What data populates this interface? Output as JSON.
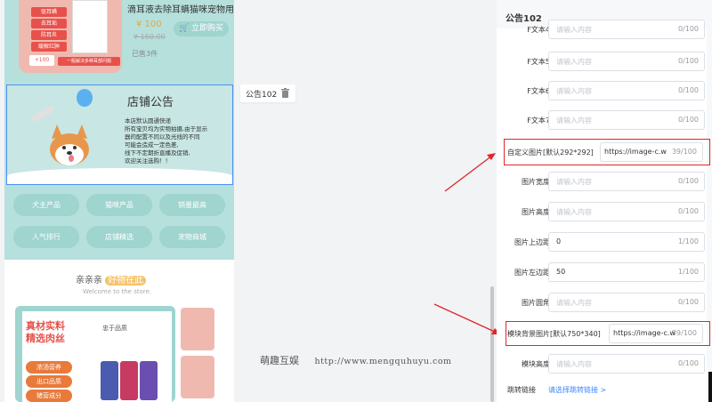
{
  "preview": {
    "product": {
      "title": "滴耳液去除耳螨猫咪宠物用",
      "price": "¥ 100",
      "old_price": "¥ 150.00",
      "buy_label": "立即购买",
      "sold": "已售3件",
      "image_tags": [
        "驱耳螨",
        "去耳垢",
        "防耳炎",
        "缓解红肿"
      ],
      "image_strip": "+100",
      "image_banner": "一瓶解决多种耳部问题"
    },
    "notice": {
      "title": "店铺公告",
      "lines": [
        "本店默认圆通快递",
        "所有宝贝均为实物拍摄,由于显示",
        "器的配置不同以及光线的不同",
        "可能会造成一定色差,",
        "线下不定期折直播及促销,",
        "欢迎关注选购！！"
      ]
    },
    "categories": [
      "犬主产品",
      "猫咪产品",
      "销量最高",
      "人气排行",
      "店铺精选",
      "宠物商城"
    ],
    "welcome": {
      "title_a": "亲亲亲",
      "title_b": "好物在此",
      "subtitle": "Welcome to the store."
    },
    "promo": {
      "headline_1": "真材实料",
      "headline_2": "精选肉丝",
      "brand": "忠于品质",
      "pills": [
        "浓汤营养",
        "出口品质",
        "猪营成分"
      ]
    }
  },
  "component_chip": {
    "label": "公告102"
  },
  "watermark": {
    "name": "萌趣互娱",
    "url": "http://www.mengquhuyu.com"
  },
  "panel": {
    "title": "公告102",
    "fields": [
      {
        "label": "F文本4",
        "placeholder": "请输入内容",
        "count": "0/100"
      },
      {
        "label": "F文本5",
        "placeholder": "请输入内容",
        "count": "0/100"
      },
      {
        "label": "F文本6",
        "placeholder": "请输入内容",
        "count": "0/100"
      },
      {
        "label": "F文本7",
        "placeholder": "请输入内容",
        "count": "0/100"
      },
      {
        "label": "自定义图片[默认292*292]",
        "value": "https://image-c.wein",
        "count": "39/100"
      },
      {
        "label": "图片宽度",
        "placeholder": "请输入内容",
        "count": "0/100"
      },
      {
        "label": "图片高度",
        "placeholder": "请输入内容",
        "count": "0/100"
      },
      {
        "label": "图片上边距",
        "value": "0",
        "count": "1/100"
      },
      {
        "label": "图片左边距",
        "value": "50",
        "count": "1/100"
      },
      {
        "label": "图片圆角",
        "placeholder": "请输入内容",
        "count": "0/100"
      },
      {
        "label": "模块背景图片[默认750*340]",
        "value": "https://image-c.w",
        "count": "39/100"
      },
      {
        "label": "模块高度",
        "placeholder": "请输入内容",
        "count": "0/100"
      }
    ],
    "link": {
      "label": "跳转链接",
      "value": "请选择跳转链接 >"
    }
  },
  "colors": {
    "accent": "#9fd4cf",
    "highlight": "#e0262b",
    "link": "#3a86ff"
  }
}
